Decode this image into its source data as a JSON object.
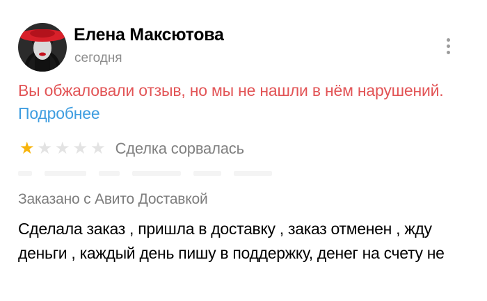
{
  "review": {
    "author_name": "Елена Максютова",
    "date": "сегодня",
    "appeal_notice": "Вы обжаловали отзыв, но мы не нашли в нём нарушений.",
    "more_link": "Подробнее",
    "rating": {
      "value": 1,
      "max": 5,
      "label": "Сделка сорвалась"
    },
    "delivery_label": "Заказано с Авито Доставкой",
    "text": "Сделала заказ , пришла в доставку , заказ отменен , жду деньги , каждый день пишу в поддержку, денег на счету не"
  },
  "icons": {
    "more": "vertical-dots-icon",
    "star": "star-icon"
  },
  "colors": {
    "notice": "#e25456",
    "link": "#3e9de0",
    "star_filled": "#f7b40c",
    "star_empty": "#e3e3e3"
  }
}
